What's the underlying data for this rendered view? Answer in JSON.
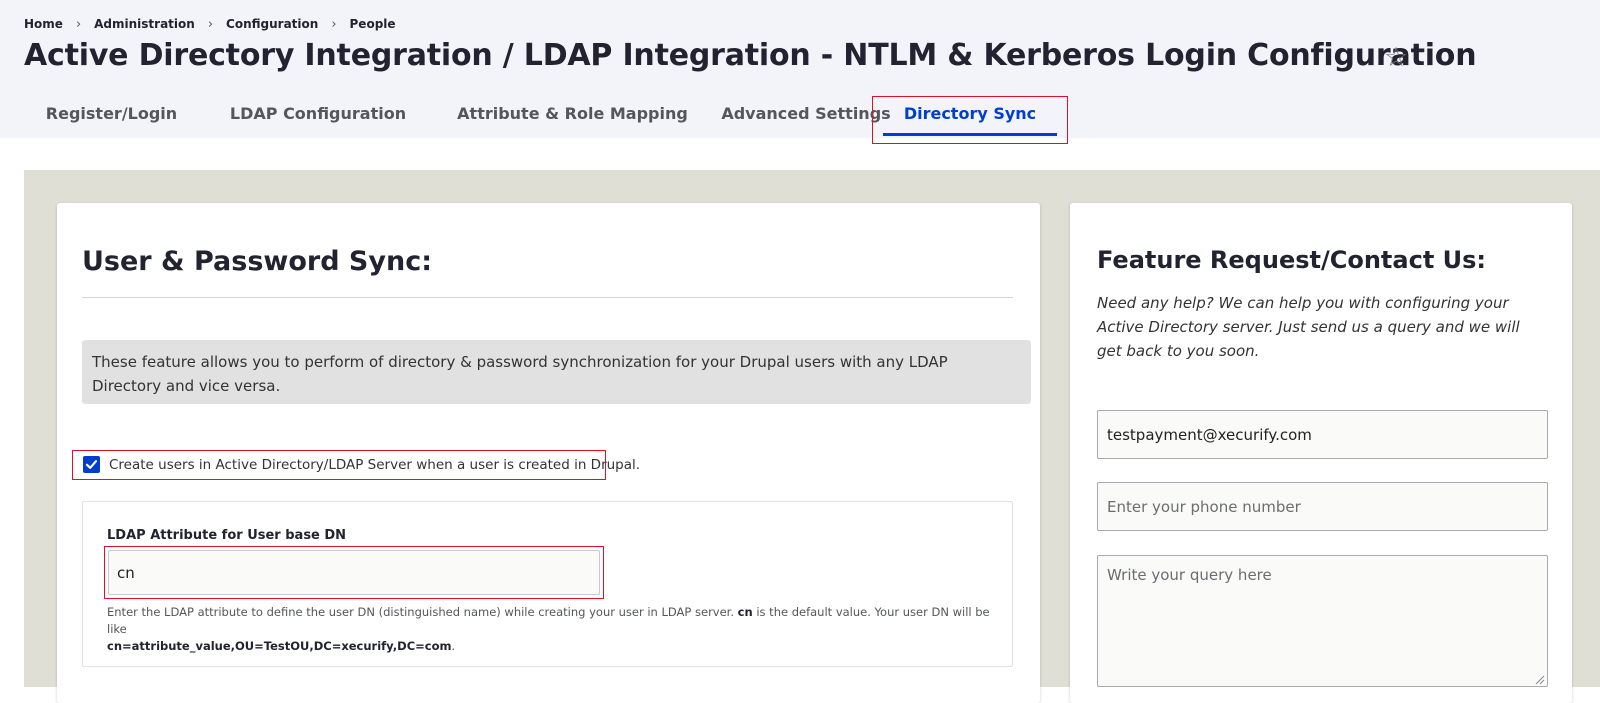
{
  "breadcrumb": [
    "Home",
    "Administration",
    "Configuration",
    "People"
  ],
  "page_title": "Active Directory Integration / LDAP Integration - NTLM & Kerberos Login Configuration",
  "favorite_icon": "star-icon",
  "tabs": [
    {
      "label": "Register/Login",
      "active": false
    },
    {
      "label": "LDAP Configuration",
      "active": false
    },
    {
      "label": "Attribute & Role Mapping",
      "active": false
    },
    {
      "label": "Advanced Settings",
      "active": false
    },
    {
      "label": "Directory Sync",
      "active": true
    }
  ],
  "left": {
    "title": "User & Password Sync:",
    "info": "These feature allows you to perform of directory & password synchronization for your Drupal users with any LDAP Directory and vice versa.",
    "checkbox_label": "Create users in Active Directory/LDAP Server when a user is created in Drupal.",
    "checkbox_checked": true,
    "field_label": "LDAP Attribute for User base DN",
    "field_value": "cn",
    "help_prefix": "Enter the LDAP attribute to define the user DN (distinguished name) while creating your user in LDAP server. ",
    "help_bold_default": "cn",
    "help_middle": " is the default value. Your user DN will be like ",
    "help_bold_example": "cn=attribute_value,OU=TestOU,DC=xecurify,DC=com",
    "help_suffix": "."
  },
  "right": {
    "title": "Feature Request/Contact Us:",
    "description": "Need any help? We can help you with configuring your Active Directory server. Just send us a query and we will get back to you soon.",
    "email_value": "testpayment@xecurify.com",
    "phone_placeholder": "Enter your phone number",
    "query_placeholder": "Write your query here"
  },
  "colors": {
    "accent": "#003ecc",
    "highlight": "#e0102a",
    "canvas": "#dfdfd6"
  }
}
